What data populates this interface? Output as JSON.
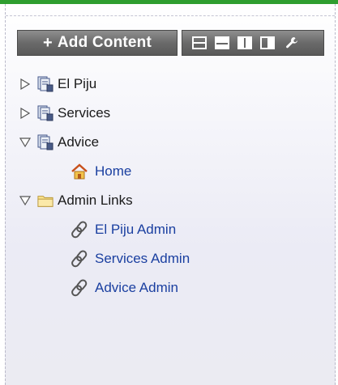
{
  "toolbar": {
    "add_label": "Add Content",
    "layout_icons": [
      "layout-rows-icon",
      "layout-split-rows-icon",
      "layout-columns-icon",
      "layout-wide-column-icon",
      "wrench-icon"
    ]
  },
  "tree": {
    "items": [
      {
        "label": "El Piju",
        "state": "collapsed",
        "icon": "page-stack-icon"
      },
      {
        "label": "Services",
        "state": "collapsed",
        "icon": "page-stack-icon"
      },
      {
        "label": "Advice",
        "state": "expanded",
        "icon": "page-stack-icon",
        "children": [
          {
            "label": "Home",
            "icon": "home-icon"
          }
        ]
      },
      {
        "label": "Admin Links",
        "state": "expanded",
        "icon": "folder-icon",
        "children": [
          {
            "label": "El Piju Admin",
            "icon": "link-icon"
          },
          {
            "label": "Services Admin",
            "icon": "link-icon"
          },
          {
            "label": "Advice Admin",
            "icon": "link-icon"
          }
        ]
      }
    ]
  },
  "colors": {
    "accent_line": "#2f9e2f",
    "link_text": "#1a3fa0",
    "toolbar_bg": "#6a6a6a"
  }
}
